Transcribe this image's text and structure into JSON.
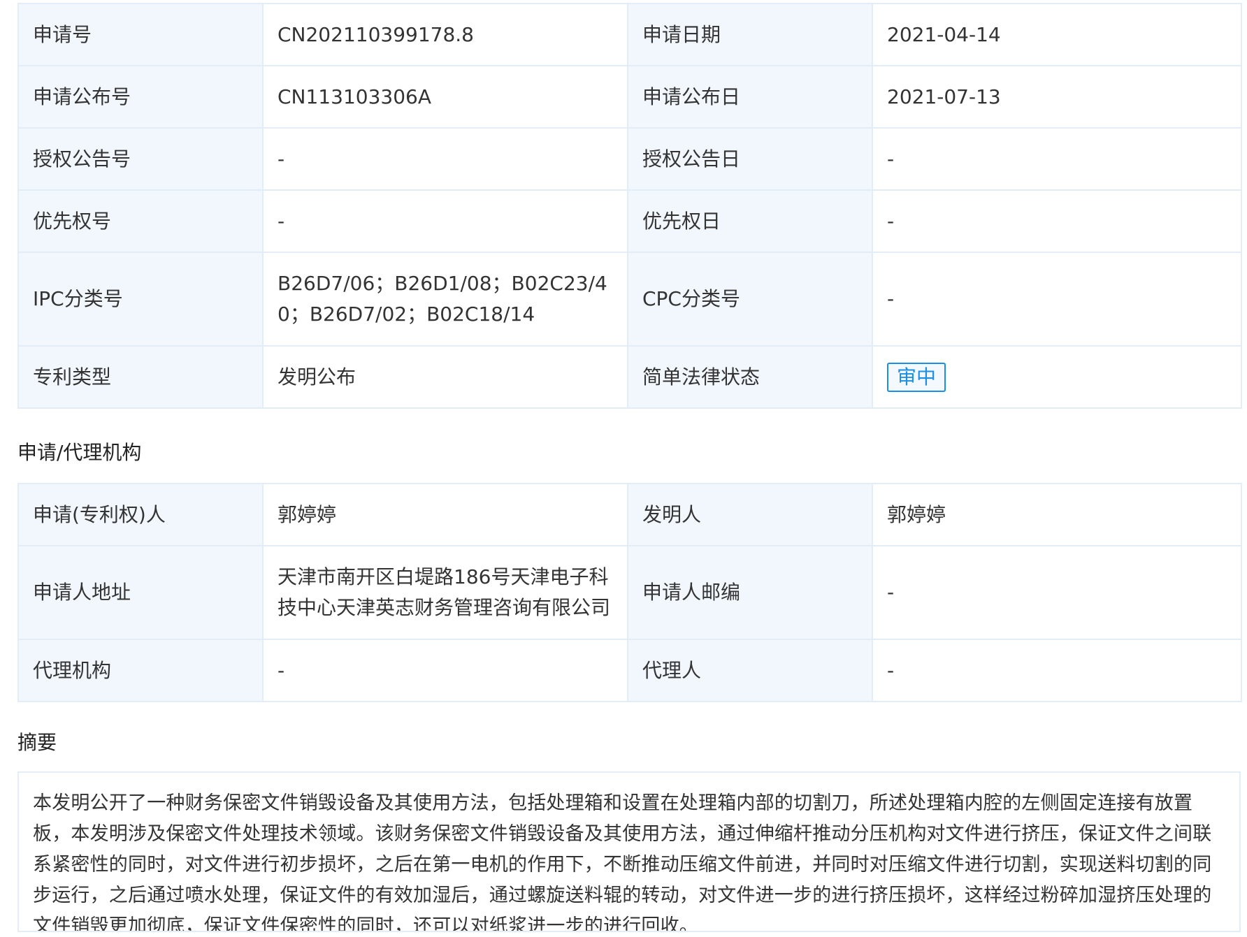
{
  "basic_info": {
    "rows": [
      {
        "label1": "申请号",
        "value1": "CN202110399178.8",
        "label2": "申请日期",
        "value2": "2021-04-14"
      },
      {
        "label1": "申请公布号",
        "value1": "CN113103306A",
        "label2": "申请公布日",
        "value2": "2021-07-13"
      },
      {
        "label1": "授权公告号",
        "value1": "-",
        "label2": "授权公告日",
        "value2": "-"
      },
      {
        "label1": "优先权号",
        "value1": "-",
        "label2": "优先权日",
        "value2": "-"
      },
      {
        "label1": "IPC分类号",
        "value1": "B26D7/06；B26D1/08；B02C23/40；B26D7/02；B02C18/14",
        "label2": "CPC分类号",
        "value2": "-"
      },
      {
        "label1": "专利类型",
        "value1": "发明公布",
        "label2": "简单法律状态",
        "value2": "审中"
      }
    ]
  },
  "agency_section": {
    "title": "申请/代理机构",
    "rows": [
      {
        "label1": "申请(专利权)人",
        "value1": "郭婷婷",
        "label2": "发明人",
        "value2": "郭婷婷"
      },
      {
        "label1": "申请人地址",
        "value1": "天津市南开区白堤路186号天津电子科技中心天津英志财务管理咨询有限公司",
        "label2": "申请人邮编",
        "value2": "-"
      },
      {
        "label1": "代理机构",
        "value1": "-",
        "label2": "代理人",
        "value2": "-"
      }
    ]
  },
  "abstract_section": {
    "title": "摘要",
    "text": "本发明公开了一种财务保密文件销毁设备及其使用方法，包括处理箱和设置在处理箱内部的切割刀，所述处理箱内腔的左侧固定连接有放置板，本发明涉及保密文件处理技术领域。该财务保密文件销毁设备及其使用方法，通过伸缩杆推动分压机构对文件进行挤压，保证文件之间联系紧密性的同时，对文件进行初步损坏，之后在第一电机的作用下，不断推动压缩文件前进，并同时对压缩文件进行切割，实现送料切割的同步运行，之后通过喷水处理，保证文件的有效加湿后，通过螺旋送料辊的转动，对文件进一步的进行挤压损坏，这样经过粉碎加湿挤压处理的文件销毁更加彻底，保证文件保密性的同时，还可以对纸浆进一步的进行回收。"
  },
  "colors": {
    "label_bg": "#f1f7fd",
    "border": "#e3edf7",
    "status_accent": "#1a8fe3"
  }
}
